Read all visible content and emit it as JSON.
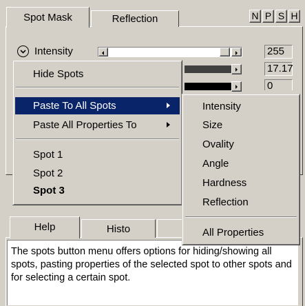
{
  "top_tabs": [
    {
      "label": "Spot Mask",
      "active": true
    },
    {
      "label": "Reflection",
      "active": false
    }
  ],
  "toggle_buttons": [
    "N",
    "P",
    "S",
    "H"
  ],
  "intensity": {
    "label": "Intensity",
    "value": "255",
    "level": 1.0
  },
  "row2": {
    "value": "17.17"
  },
  "row3": {
    "value": "0"
  },
  "context_menu": {
    "items": [
      {
        "label": "Hide Spots"
      },
      {
        "label": "Paste To All Spots"
      },
      {
        "label": "Paste All Properties To"
      },
      {
        "label": "Spot 1"
      },
      {
        "label": "Spot 2"
      },
      {
        "label": "Spot 3"
      }
    ]
  },
  "submenu": {
    "items": [
      "Intensity",
      "Size",
      "Ovality",
      "Angle",
      "Hardness",
      "Reflection",
      "All Properties"
    ]
  },
  "bottom_tabs": [
    {
      "label": "Help",
      "active": true
    },
    {
      "label": "Histo",
      "active": false
    }
  ],
  "help_text": "The spots button menu offers options for hiding/showing all spots, pasting properties of the selected spot to other spots and for selecting a certain spot."
}
